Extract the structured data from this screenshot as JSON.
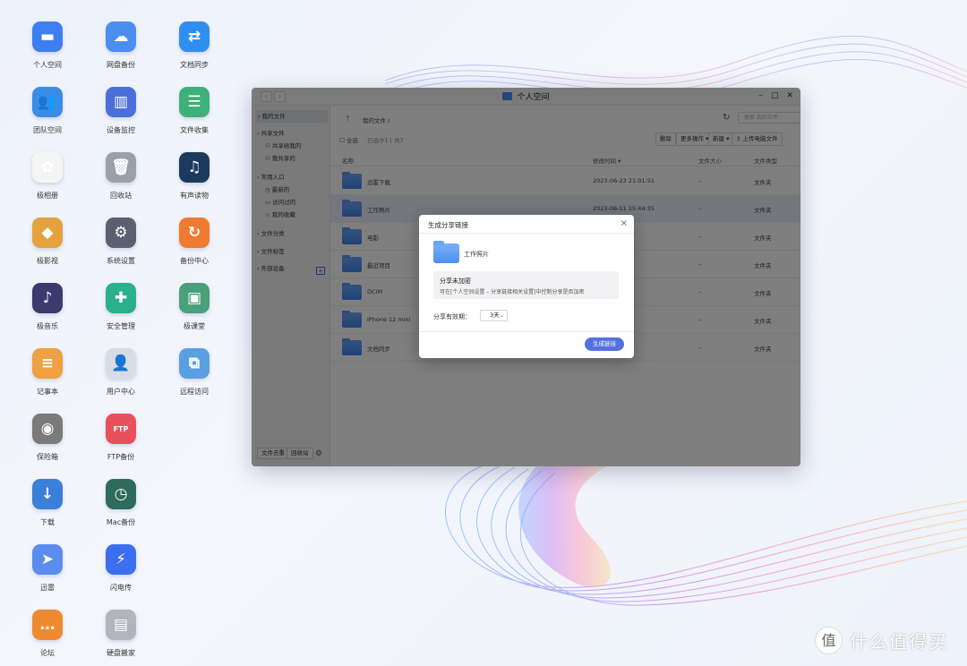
{
  "desktop_icons": [
    {
      "label": "个人空间",
      "icon": "folder-icon",
      "color": "#3d7ff0",
      "glyph": "▬"
    },
    {
      "label": "团队空间",
      "icon": "team-folder-icon",
      "color": "#3a8de6",
      "glyph": "👥"
    },
    {
      "label": "极相册",
      "icon": "photos-icon",
      "color": "#f5f5f5",
      "glyph": "✿"
    },
    {
      "label": "极影视",
      "icon": "video-icon",
      "color": "#e6a23c",
      "glyph": "◆"
    },
    {
      "label": "极音乐",
      "icon": "music-icon",
      "color": "#3b3a6e",
      "glyph": "♪"
    },
    {
      "label": "记事本",
      "icon": "notepad-icon",
      "color": "#f0a040",
      "glyph": "≡"
    },
    {
      "label": "保险箱",
      "icon": "safe-icon",
      "color": "#7a7a7a",
      "glyph": "◉"
    },
    {
      "label": "下载",
      "icon": "download-icon",
      "color": "#3a7fd8",
      "glyph": "↓"
    },
    {
      "label": "迅雷",
      "icon": "thunder-icon",
      "color": "#5b8cf0",
      "glyph": "➤"
    },
    {
      "label": "论坛",
      "icon": "forum-icon",
      "color": "#f08a30",
      "glyph": "…"
    },
    {
      "label": "网盘备份",
      "icon": "cloud-backup-icon",
      "color": "#4a8ef0",
      "glyph": "☁"
    },
    {
      "label": "设备监控",
      "icon": "monitor-chart-icon",
      "color": "#4b6fd8",
      "glyph": "▥"
    },
    {
      "label": "回收站",
      "icon": "trash-icon",
      "color": "#9aa0a8",
      "glyph": "🗑"
    },
    {
      "label": "系统设置",
      "icon": "settings-icon",
      "color": "#5a6070",
      "glyph": "⚙"
    },
    {
      "label": "安全管理",
      "icon": "shield-icon",
      "color": "#2ab08a",
      "glyph": "✚"
    },
    {
      "label": "用户中心",
      "icon": "user-icon",
      "color": "#d8dce4",
      "glyph": "👤"
    },
    {
      "label": "FTP备份",
      "icon": "ftp-icon",
      "color": "#e8505b",
      "glyph": "FTP"
    },
    {
      "label": "Mac备份",
      "icon": "time-machine-icon",
      "color": "#2f6b5c",
      "glyph": "◷"
    },
    {
      "label": "闪电传",
      "icon": "lightning-icon",
      "color": "#3c6ff0",
      "glyph": "⚡"
    },
    {
      "label": "硬盘搬家",
      "icon": "disk-icon",
      "color": "#b0b4bc",
      "glyph": "▤"
    },
    {
      "label": "文档同步",
      "icon": "sync-icon",
      "color": "#2f8ff0",
      "glyph": "⇄"
    },
    {
      "label": "文件收集",
      "icon": "collect-icon",
      "color": "#3fb07a",
      "glyph": "☰"
    },
    {
      "label": "有声读物",
      "icon": "audiobook-icon",
      "color": "#1c3a5e",
      "glyph": "♫"
    },
    {
      "label": "备份中心",
      "icon": "backup-center-icon",
      "color": "#f07a30",
      "glyph": "↻"
    },
    {
      "label": "极课堂",
      "icon": "classroom-icon",
      "color": "#4aa07a",
      "glyph": "▣"
    },
    {
      "label": "远程访问",
      "icon": "remote-access-icon",
      "color": "#5aa0e0",
      "glyph": "⧉"
    }
  ],
  "window": {
    "title": "个人空间",
    "sidebar": {
      "my_files": "我的文件",
      "shared_files": "共享文件",
      "shared_to_me": "共享给我的",
      "my_shared": "我共享的",
      "common": "常用入口",
      "recent": "最新的",
      "visited": "访问过的",
      "favorites": "我的收藏",
      "file_category": "文件分类",
      "file_tags": "文件标签",
      "external": "外部设备",
      "btn_dedup": "文件去重",
      "btn_recycle": "回收站"
    },
    "toolbar": {
      "path": "我的文件 /",
      "search_placeholder": "搜索 我的文件",
      "select_all": "全选",
      "selected_count": "已选中1 | 共7",
      "delete": "删除",
      "more_ops": "更多操作",
      "new": "新建",
      "upload": "上传电脑文件"
    },
    "table": {
      "headers": {
        "name": "名称",
        "modified": "修改时间",
        "size": "文件大小",
        "type": "文件类型"
      },
      "rows": [
        {
          "name": "迅雷下载",
          "modified": "2023-06-23 21:01:51",
          "size": "–",
          "type": "文件夹"
        },
        {
          "name": "工作照片",
          "modified": "2023-06-11 15:44:35",
          "size": "–",
          "type": "文件夹"
        },
        {
          "name": "电影",
          "modified": "20:42",
          "size": "–",
          "type": "文件夹"
        },
        {
          "name": "最近项目",
          "modified": "04:06",
          "size": "–",
          "type": "文件夹"
        },
        {
          "name": "DCIM",
          "modified": "35:50",
          "size": "–",
          "type": "文件夹"
        },
        {
          "name": "iPhone 12 mini",
          "modified": "52:44",
          "size": "–",
          "type": "文件夹"
        },
        {
          "name": "文档同步",
          "modified": "16:05",
          "size": "–",
          "type": "文件夹"
        }
      ],
      "selected_index": 1
    }
  },
  "dialog": {
    "title": "生成分享链接",
    "folder_name": "工作照片",
    "notice_title": "分享未加密",
    "notice_text": "可在[个人空间设置 – 分享链接相关设置]中控制分享是否加密",
    "expiry_label": "分享有效期：",
    "expiry_value": "3天",
    "button": "生成链接"
  },
  "watermark": {
    "text": "什么值得买",
    "logo": "值"
  }
}
